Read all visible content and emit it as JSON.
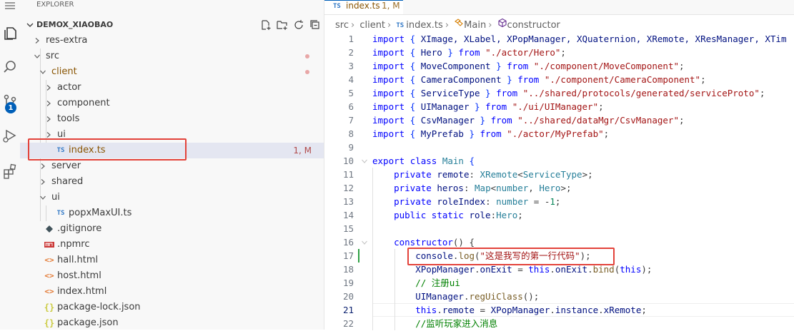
{
  "activity_bar": {
    "icons": [
      "menu-icon",
      "files-icon",
      "search-icon",
      "source-control-icon",
      "run-debug-icon",
      "extensions-icon"
    ],
    "scm_badge": "1"
  },
  "explorer": {
    "title": "EXPLORER",
    "root": "DEMOX_XIAOBAO",
    "tree": [
      {
        "label": "res-extra",
        "kind": "folder",
        "expanded": false,
        "depth": 0
      },
      {
        "label": "src",
        "kind": "folder",
        "expanded": true,
        "depth": 0,
        "dot": true
      },
      {
        "label": "client",
        "kind": "folder",
        "expanded": true,
        "depth": 1,
        "dot": true,
        "modified": true
      },
      {
        "label": "actor",
        "kind": "folder",
        "expanded": false,
        "depth": 2
      },
      {
        "label": "component",
        "kind": "folder",
        "expanded": false,
        "depth": 2
      },
      {
        "label": "tools",
        "kind": "folder",
        "expanded": false,
        "depth": 2
      },
      {
        "label": "ui",
        "kind": "folder",
        "expanded": false,
        "depth": 2
      },
      {
        "label": "index.ts",
        "kind": "ts",
        "depth": 2,
        "selected": true,
        "modified": true,
        "decoration": "1, M"
      },
      {
        "label": "server",
        "kind": "folder",
        "expanded": false,
        "depth": 1
      },
      {
        "label": "shared",
        "kind": "folder",
        "expanded": false,
        "depth": 1
      },
      {
        "label": "ui",
        "kind": "folder",
        "expanded": true,
        "depth": 1
      },
      {
        "label": "popxMaxUI.ts",
        "kind": "ts",
        "depth": 2
      },
      {
        "label": ".gitignore",
        "kind": "git",
        "depth": 0
      },
      {
        "label": ".npmrc",
        "kind": "npm",
        "depth": 0
      },
      {
        "label": "hall.html",
        "kind": "html",
        "depth": 0
      },
      {
        "label": "host.html",
        "kind": "html",
        "depth": 0
      },
      {
        "label": "index.html",
        "kind": "html",
        "depth": 0
      },
      {
        "label": "package-lock.json",
        "kind": "json",
        "depth": 0
      },
      {
        "label": "package.json",
        "kind": "json",
        "depth": 0
      }
    ]
  },
  "editor": {
    "tab": {
      "icon_text": "TS",
      "name": "index.ts",
      "decoration": "1, M"
    },
    "breadcrumb": [
      "src",
      "client",
      "index.ts",
      "Main",
      "constructor"
    ],
    "lines": [
      {
        "n": "1",
        "tokens": [
          [
            "import",
            "k"
          ],
          [
            " { ",
            "p"
          ],
          [
            "XImage, XLabel, XPopManager, XQuaternion, XRemote, XResManager, XTim",
            "v"
          ]
        ]
      },
      {
        "n": "2",
        "tokens": [
          [
            "import",
            "k"
          ],
          [
            " { ",
            "p"
          ],
          [
            "Hero",
            "v"
          ],
          [
            " } ",
            "p"
          ],
          [
            "from",
            "k"
          ],
          [
            " ",
            ""
          ],
          [
            "\"./actor/Hero\"",
            "s"
          ],
          [
            ";",
            ""
          ]
        ]
      },
      {
        "n": "3",
        "tokens": [
          [
            "import",
            "k"
          ],
          [
            " { ",
            "p"
          ],
          [
            "MoveComponent",
            "v"
          ],
          [
            " } ",
            "p"
          ],
          [
            "from",
            "k"
          ],
          [
            " ",
            ""
          ],
          [
            "\"./component/MoveComponent\"",
            "s"
          ],
          [
            ";",
            ""
          ]
        ]
      },
      {
        "n": "4",
        "tokens": [
          [
            "import",
            "k"
          ],
          [
            " { ",
            "p"
          ],
          [
            "CameraComponent",
            "v"
          ],
          [
            " } ",
            "p"
          ],
          [
            "from",
            "k"
          ],
          [
            " ",
            ""
          ],
          [
            "\"./component/CameraComponent\"",
            "s"
          ],
          [
            ";",
            ""
          ]
        ]
      },
      {
        "n": "5",
        "tokens": [
          [
            "import",
            "k"
          ],
          [
            " { ",
            "p"
          ],
          [
            "ServiceType",
            "v"
          ],
          [
            " } ",
            "p"
          ],
          [
            "from",
            "k"
          ],
          [
            " ",
            ""
          ],
          [
            "\"../shared/protocols/generated/serviceProto\"",
            "s"
          ],
          [
            ";",
            ""
          ]
        ]
      },
      {
        "n": "6",
        "tokens": [
          [
            "import",
            "k"
          ],
          [
            " { ",
            "p"
          ],
          [
            "UIManager",
            "v"
          ],
          [
            " } ",
            "p"
          ],
          [
            "from",
            "k"
          ],
          [
            " ",
            ""
          ],
          [
            "\"./ui/UIManager\"",
            "s"
          ],
          [
            ";",
            ""
          ]
        ]
      },
      {
        "n": "7",
        "tokens": [
          [
            "import",
            "k"
          ],
          [
            " { ",
            "p"
          ],
          [
            "CsvManager",
            "v"
          ],
          [
            " } ",
            "p"
          ],
          [
            "from",
            "k"
          ],
          [
            " ",
            ""
          ],
          [
            "\"../shared/dataMgr/CsvManager\"",
            "s"
          ],
          [
            ";",
            ""
          ]
        ]
      },
      {
        "n": "8",
        "tokens": [
          [
            "import",
            "k"
          ],
          [
            " { ",
            "p"
          ],
          [
            "MyPrefab",
            "v"
          ],
          [
            " } ",
            "p"
          ],
          [
            "from",
            "k"
          ],
          [
            " ",
            ""
          ],
          [
            "\"./actor/MyPrefab\"",
            "s"
          ],
          [
            ";",
            ""
          ]
        ]
      },
      {
        "n": "9",
        "tokens": []
      },
      {
        "n": "10",
        "tokens": [
          [
            "export",
            "k"
          ],
          [
            " ",
            ""
          ],
          [
            "class",
            "k"
          ],
          [
            " ",
            ""
          ],
          [
            "Main",
            "t"
          ],
          [
            " {",
            "p"
          ]
        ]
      },
      {
        "n": "11",
        "tokens": [
          [
            "    ",
            ""
          ],
          [
            "private",
            "k"
          ],
          [
            " ",
            ""
          ],
          [
            "remote",
            "v"
          ],
          [
            ": ",
            ""
          ],
          [
            "XRemote",
            "t"
          ],
          [
            "<",
            ""
          ],
          [
            "ServiceType",
            "t"
          ],
          [
            ">;",
            ""
          ]
        ]
      },
      {
        "n": "12",
        "tokens": [
          [
            "    ",
            ""
          ],
          [
            "private",
            "k"
          ],
          [
            " ",
            ""
          ],
          [
            "heros",
            "v"
          ],
          [
            ": ",
            ""
          ],
          [
            "Map",
            "t"
          ],
          [
            "<",
            ""
          ],
          [
            "number",
            "t"
          ],
          [
            ", ",
            ""
          ],
          [
            "Hero",
            "t"
          ],
          [
            ">;",
            ""
          ]
        ]
      },
      {
        "n": "13",
        "tokens": [
          [
            "    ",
            ""
          ],
          [
            "private",
            "k"
          ],
          [
            " ",
            ""
          ],
          [
            "roleIndex",
            "v"
          ],
          [
            ": ",
            ""
          ],
          [
            "number",
            "t"
          ],
          [
            " = -",
            ""
          ],
          [
            "1",
            "n"
          ],
          [
            ";",
            ""
          ]
        ]
      },
      {
        "n": "14",
        "tokens": [
          [
            "    ",
            ""
          ],
          [
            "public",
            "k"
          ],
          [
            " ",
            ""
          ],
          [
            "static",
            "k"
          ],
          [
            " ",
            ""
          ],
          [
            "role",
            "v"
          ],
          [
            ":",
            ""
          ],
          [
            "Hero",
            "t"
          ],
          [
            ";",
            ""
          ]
        ]
      },
      {
        "n": "15",
        "tokens": []
      },
      {
        "n": "16",
        "tokens": [
          [
            "    ",
            ""
          ],
          [
            "constructor",
            "k"
          ],
          [
            "() {",
            ""
          ]
        ]
      },
      {
        "n": "17",
        "tokens": [
          [
            "        ",
            ""
          ],
          [
            "console",
            "v"
          ],
          [
            ".",
            ""
          ],
          [
            "log",
            "f"
          ],
          [
            "(",
            ""
          ],
          [
            "\"这是我写的第一行代码\"",
            "s"
          ],
          [
            ");",
            ""
          ]
        ]
      },
      {
        "n": "18",
        "tokens": [
          [
            "        ",
            ""
          ],
          [
            "XPopManager",
            "v"
          ],
          [
            ".",
            ""
          ],
          [
            "onExit",
            "v"
          ],
          [
            " = ",
            ""
          ],
          [
            "this",
            "k"
          ],
          [
            ".",
            ""
          ],
          [
            "onExit",
            "v"
          ],
          [
            ".",
            ""
          ],
          [
            "bind",
            "f"
          ],
          [
            "(",
            ""
          ],
          [
            "this",
            "k"
          ],
          [
            ");",
            ""
          ]
        ]
      },
      {
        "n": "19",
        "tokens": [
          [
            "        ",
            ""
          ],
          [
            "// 注册ui",
            "c"
          ]
        ]
      },
      {
        "n": "20",
        "tokens": [
          [
            "        ",
            ""
          ],
          [
            "UIManager",
            "v"
          ],
          [
            ".",
            ""
          ],
          [
            "regUiClass",
            "f"
          ],
          [
            "();",
            ""
          ]
        ]
      },
      {
        "n": "21",
        "tokens": [
          [
            "        ",
            ""
          ],
          [
            "this",
            "k"
          ],
          [
            ".",
            ""
          ],
          [
            "remote",
            "v"
          ],
          [
            " = ",
            ""
          ],
          [
            "XPopManager",
            "v"
          ],
          [
            ".",
            ""
          ],
          [
            "instance",
            "v"
          ],
          [
            ".",
            ""
          ],
          [
            "xRemote",
            "v"
          ],
          [
            ";",
            ""
          ]
        ]
      },
      {
        "n": "22",
        "tokens": [
          [
            "        ",
            ""
          ],
          [
            "//监听玩家进入消息",
            "c"
          ]
        ]
      }
    ]
  }
}
